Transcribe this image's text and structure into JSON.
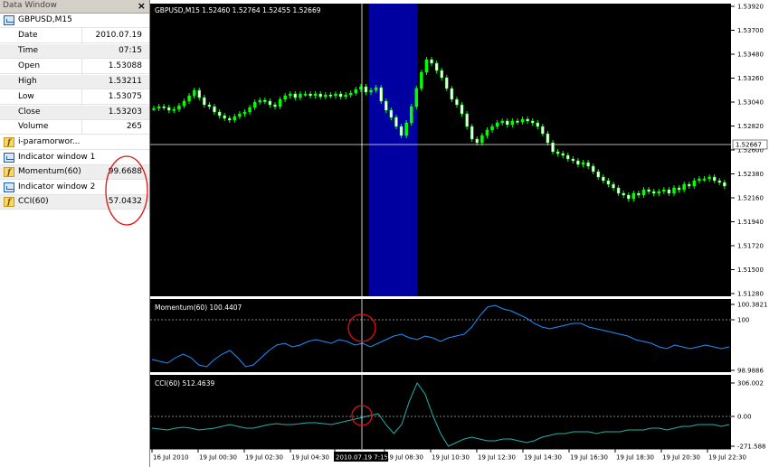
{
  "data_window": {
    "title": "Data Window",
    "close_glyph": "×",
    "symbol_header": "GBPUSD,M15",
    "rows": [
      {
        "label": "Date",
        "value": "2010.07.19"
      },
      {
        "label": "Time",
        "value": "07:15"
      },
      {
        "label": "Open",
        "value": "1.53088"
      },
      {
        "label": "High",
        "value": "1.53211"
      },
      {
        "label": "Low",
        "value": "1.53075"
      },
      {
        "label": "Close",
        "value": "1.53203"
      },
      {
        "label": "Volume",
        "value": "265"
      }
    ],
    "indicators": [
      {
        "label": "i-paramorwor...",
        "value": "",
        "icon": "custom-indicator-icon"
      },
      {
        "label": "Indicator window 1",
        "value": "",
        "icon": "indicator-window-icon"
      },
      {
        "label": "Momentum(60)",
        "value": "99.6688",
        "icon": "custom-indicator-icon"
      },
      {
        "label": "Indicator window 2",
        "value": "",
        "icon": "indicator-window-icon"
      },
      {
        "label": "CCI(60)",
        "value": "57.0432",
        "icon": "custom-indicator-icon"
      }
    ],
    "annotation_color": "#e01010"
  },
  "chart": {
    "main_label": "GBPUSD,M15  1.52460  1.52764  1.52455  1.52669",
    "price_ticks": [
      "1.53920",
      "1.53700",
      "1.53480",
      "1.53260",
      "1.53040",
      "1.52820",
      "1.52600",
      "1.52380",
      "1.52160",
      "1.51940",
      "1.51720",
      "1.51500",
      "1.51280"
    ],
    "current_price": "1.52667",
    "momentum_label": "Momentum(60) 100.4407",
    "momentum_ticks": [
      "100.3821",
      "100",
      "98.9886"
    ],
    "cci_label": "CCI(60) 512.4639",
    "cci_ticks": [
      "306.002",
      "0.00",
      "-271.588"
    ],
    "time_ticks": [
      "16 Jul 2010",
      "19 Jul 00:30",
      "19 Jul 02:30",
      "19 Jul 04:30",
      "2010.07.19 7:15",
      "19 Jul 08:30",
      "19 Jul 10:30",
      "19 Jul 12:30",
      "19 Jul 14:30",
      "19 Jul 16:30",
      "19 Jul 18:30",
      "19 Jul 20:30",
      "19 Jul 22:30"
    ],
    "colors": {
      "background": "#000000",
      "bull": "#00ff00",
      "bear": "#ffffff",
      "highlight": "#0000a0",
      "momentum_line": "#1e90ff",
      "cci_line": "#20b2aa",
      "crosshair": "#ffffff",
      "annotation": "#e01010"
    }
  }
}
